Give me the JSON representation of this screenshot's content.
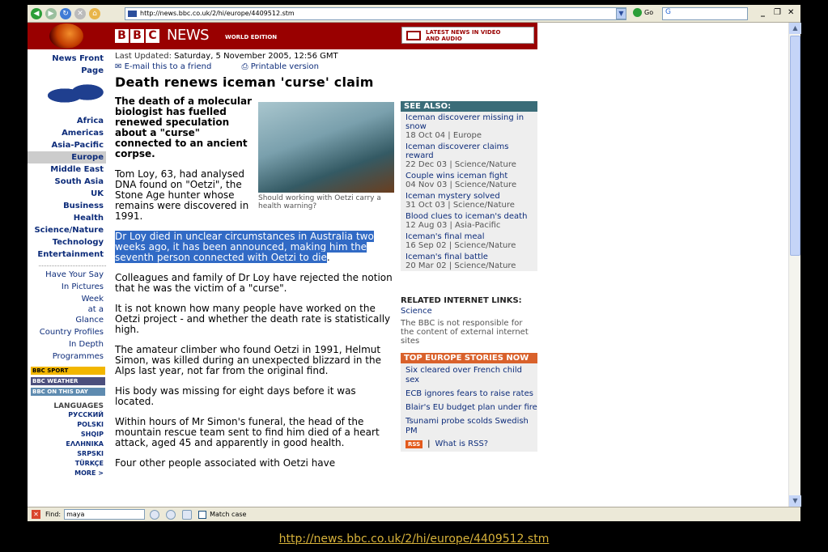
{
  "browser": {
    "address_url": "http://news.bbc.co.uk/2/hi/europe/4409512.stm",
    "go_label": "Go",
    "google_box": "G",
    "find_label": "Find:",
    "find_value": "maya",
    "match_case_label": "Match case"
  },
  "caption_url": "http://news.bbc.co.uk/2/hi/europe/4409512.stm",
  "header": {
    "logo_letters": [
      "B",
      "B",
      "C"
    ],
    "news": "NEWS",
    "edition": "WORLD EDITION",
    "latest_line1": "LATEST NEWS IN VIDEO",
    "latest_line2": "AND AUDIO"
  },
  "nav": {
    "front": "News Front Page",
    "regions": [
      "Africa",
      "Americas",
      "Asia-Pacific",
      "Europe",
      "Middle East",
      "South Asia",
      "UK",
      "Business",
      "Health",
      "Science/Nature",
      "Technology",
      "Entertainment"
    ],
    "selected": "Europe",
    "secondary": [
      "Have Your Say",
      "In Pictures",
      "Week at a Glance",
      "Country Profiles",
      "In Depth",
      "Programmes"
    ],
    "badges": [
      "BBC SPORT",
      "BBC WEATHER",
      "BBC ON THIS DAY"
    ],
    "languages_heading": "LANGUAGES",
    "languages": [
      "РУССКИЙ",
      "POLSKI",
      "SHQIP",
      "ΕΛΛΗΝΙΚΑ",
      "SRPSKI",
      "TÜRKÇE",
      "MORE >"
    ]
  },
  "article": {
    "updated_label": "Last Updated:",
    "updated": "Saturday, 5 November 2005, 12:56 GMT",
    "email": "E-mail this to a friend",
    "print": "Printable version",
    "headline": "Death renews iceman 'curse' claim",
    "intro": "The death of a molecular biologist has fuelled renewed speculation about a \"curse\" connected to an ancient corpse.",
    "photo_caption": "Should working with Oetzi carry a health warning?",
    "p1": "Tom Loy, 63, had analysed DNA found on \"Oetzi\", the Stone Age hunter whose remains were discovered in 1991.",
    "p2_highlight": "Dr Loy died in unclear circumstances in Australia two weeks ago, it has been announced, making him the seventh person connected with Oetzi to die",
    "p2_end": ".",
    "p3": "Colleagues and family of Dr Loy have rejected the notion that he was the victim of a \"curse\".",
    "p4": "It is not known how many people have worked on the Oetzi project - and whether the death rate is statistically high.",
    "p5": "The amateur climber who found Oetzi in 1991, Helmut Simon, was killed during an unexpected blizzard in the Alps last year, not far from the original find.",
    "p6": "His body was missing for eight days before it was located.",
    "p7": "Within hours of Mr Simon's funeral, the head of the mountain rescue team sent to find him died of a heart attack, aged 45 and apparently in good health.",
    "p8": "Four other people associated with Oetzi have"
  },
  "see_also": {
    "heading": "SEE ALSO:",
    "items": [
      {
        "title": "Iceman discoverer missing in snow",
        "date": "18 Oct 04 |  Europe"
      },
      {
        "title": "Iceman discoverer claims reward",
        "date": "22 Dec 03 |  Science/Nature"
      },
      {
        "title": "Couple wins iceman fight",
        "date": "04 Nov 03 |  Science/Nature"
      },
      {
        "title": "Iceman mystery solved",
        "date": "31 Oct 03 |  Science/Nature"
      },
      {
        "title": "Blood clues to iceman's death",
        "date": "12 Aug 03 |  Asia-Pacific"
      },
      {
        "title": "Iceman's final meal",
        "date": "16 Sep 02 |  Science/Nature"
      },
      {
        "title": "Iceman's final battle",
        "date": "20 Mar 02 |  Science/Nature"
      }
    ]
  },
  "internet_links": {
    "heading": "RELATED INTERNET LINKS:",
    "link": "Science",
    "note": "The BBC is not responsible for the content of external internet sites"
  },
  "top_europe": {
    "heading": "TOP EUROPE STORIES NOW",
    "items": [
      "Six cleared over French child sex",
      "ECB ignores fears to raise rates",
      "Blair's EU budget plan under fire",
      "Tsunami probe scolds Swedish PM"
    ],
    "rss_badge": "RSS",
    "rss_link": "What is RSS?"
  },
  "colors": {
    "bbc_red": "#990000",
    "see_also": "#3a6c78",
    "top_europe": "#d9612b",
    "highlight": "#316ac5"
  }
}
